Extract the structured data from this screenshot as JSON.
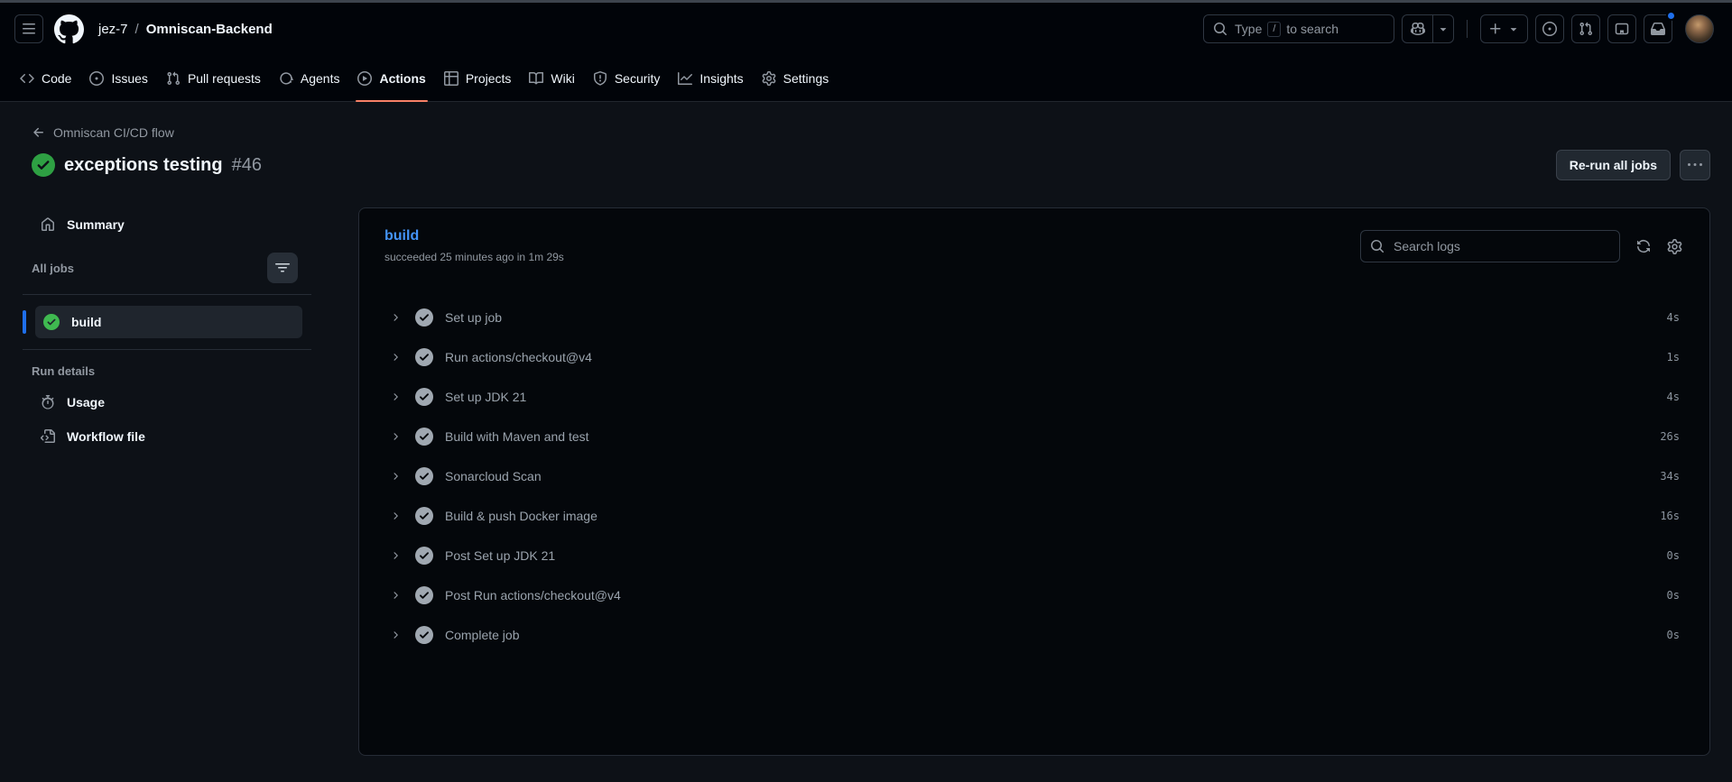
{
  "colors": {
    "page_bg": "#0d1117",
    "header_bg": "#010409",
    "accent_underline": "#f78166",
    "link_blue": "#4493f8",
    "success_green": "#3fb950",
    "selected_bar_blue": "#1f6feb",
    "unread_dot_blue": "#1f6feb"
  },
  "header": {
    "breadcrumb": {
      "owner": "jez-7",
      "separator": "/",
      "repo": "Omniscan-Backend"
    },
    "search": {
      "prefix": "Type",
      "key": "/",
      "suffix": "to search"
    },
    "icons": [
      "three-bars-icon",
      "github-mark-icon",
      "search-icon",
      "copilot-icon",
      "triangle-down-icon",
      "plus-icon",
      "issue-opened-icon",
      "git-pull-request-icon",
      "saved-panel-icon",
      "inbox-icon",
      "avatar"
    ]
  },
  "nav": {
    "active_tab": "Actions",
    "tabs": [
      {
        "label": "Code"
      },
      {
        "label": "Issues"
      },
      {
        "label": "Pull requests"
      },
      {
        "label": "Agents"
      },
      {
        "label": "Actions"
      },
      {
        "label": "Projects"
      },
      {
        "label": "Wiki"
      },
      {
        "label": "Security"
      },
      {
        "label": "Insights"
      },
      {
        "label": "Settings"
      }
    ]
  },
  "run": {
    "workflow": "Omniscan CI/CD flow",
    "title": "exceptions testing",
    "number": "#46",
    "status": "success",
    "rerun_button": "Re-run all jobs"
  },
  "sidebar": {
    "summary": "Summary",
    "all_jobs": "All jobs",
    "jobs": [
      {
        "name": "build",
        "status": "success"
      }
    ],
    "run_details": "Run details",
    "usage": "Usage",
    "workflow_file": "Workflow file"
  },
  "panel": {
    "job": "build",
    "status_line": "succeeded 25 minutes ago in 1m 29s",
    "search_placeholder": "Search logs",
    "steps": [
      {
        "name": "Set up job",
        "duration": "4s"
      },
      {
        "name": "Run actions/checkout@v4",
        "duration": "1s"
      },
      {
        "name": "Set up JDK 21",
        "duration": "4s"
      },
      {
        "name": "Build with Maven and test",
        "duration": "26s"
      },
      {
        "name": "Sonarcloud Scan",
        "duration": "34s"
      },
      {
        "name": "Build & push Docker image",
        "duration": "16s"
      },
      {
        "name": "Post Set up JDK 21",
        "duration": "0s"
      },
      {
        "name": "Post Run actions/checkout@v4",
        "duration": "0s"
      },
      {
        "name": "Complete job",
        "duration": "0s"
      }
    ]
  }
}
